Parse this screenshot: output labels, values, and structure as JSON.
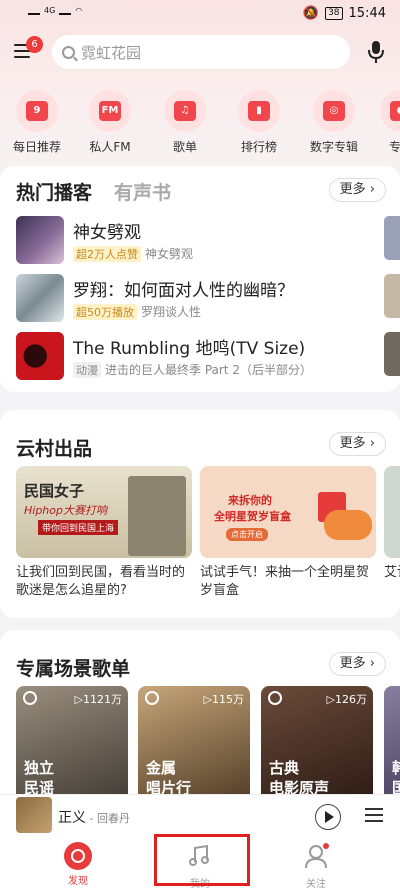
{
  "status": {
    "time": "15:44",
    "battery": "38",
    "net": "4G"
  },
  "header": {
    "badge": "6",
    "search_placeholder": "霓虹花园"
  },
  "shortcuts": [
    {
      "label": "每日推荐",
      "glyph": "9"
    },
    {
      "label": "私人FM",
      "glyph": "FM"
    },
    {
      "label": "歌单",
      "glyph": "♫"
    },
    {
      "label": "排行榜",
      "glyph": "▮"
    },
    {
      "label": "数字专辑",
      "glyph": "◎"
    },
    {
      "label": "专注",
      "glyph": "◐"
    }
  ],
  "hot": {
    "title": "热门播客",
    "title2": "有声书",
    "more": "更多 ›",
    "items": [
      {
        "title": "神女劈观",
        "tag": "超2万人点赞",
        "sub": "神女劈观"
      },
      {
        "title": "罗翔：如何面对人性的幽暗？",
        "tag": "超50万播放",
        "sub": "罗翔谈人性"
      },
      {
        "title": "The Rumbling 地鸣(TV Size)",
        "tag": "动漫",
        "sub": "进击的巨人最终季 Part 2（后半部分）"
      }
    ]
  },
  "yuncun": {
    "title": "云村出品",
    "more": "更多 ›",
    "items": [
      {
        "caption": "让我们回到民国，看看当时的歌迷是怎么追星的?",
        "img_text": "民国女子",
        "img_text2": "Hiphop大赛打响",
        "img_text3": "带你回到民国上海"
      },
      {
        "caption": "试试手气！来抽一个全明星贺岁盲盒",
        "img_text": "来拆你的",
        "img_text2": "全明星贺岁盲盒",
        "img_text3": "点击开启"
      },
      {
        "caption": "艾记",
        "img_text": "",
        "img_text2": "",
        "img_text3": ""
      }
    ]
  },
  "scene": {
    "title": "专属场景歌单",
    "more": "更多 ›",
    "items": [
      {
        "count": "▷1121万",
        "name": "独立\n民谣"
      },
      {
        "count": "▷115万",
        "name": "金属\n唱片行"
      },
      {
        "count": "▷126万",
        "name": "古典\n电影原声"
      },
      {
        "count": "",
        "name": "韩\n国"
      }
    ]
  },
  "player": {
    "song": "正义",
    "artist": " - 回春丹"
  },
  "tabs": [
    {
      "label": "发现"
    },
    {
      "label": "我的"
    },
    {
      "label": "关注"
    }
  ]
}
